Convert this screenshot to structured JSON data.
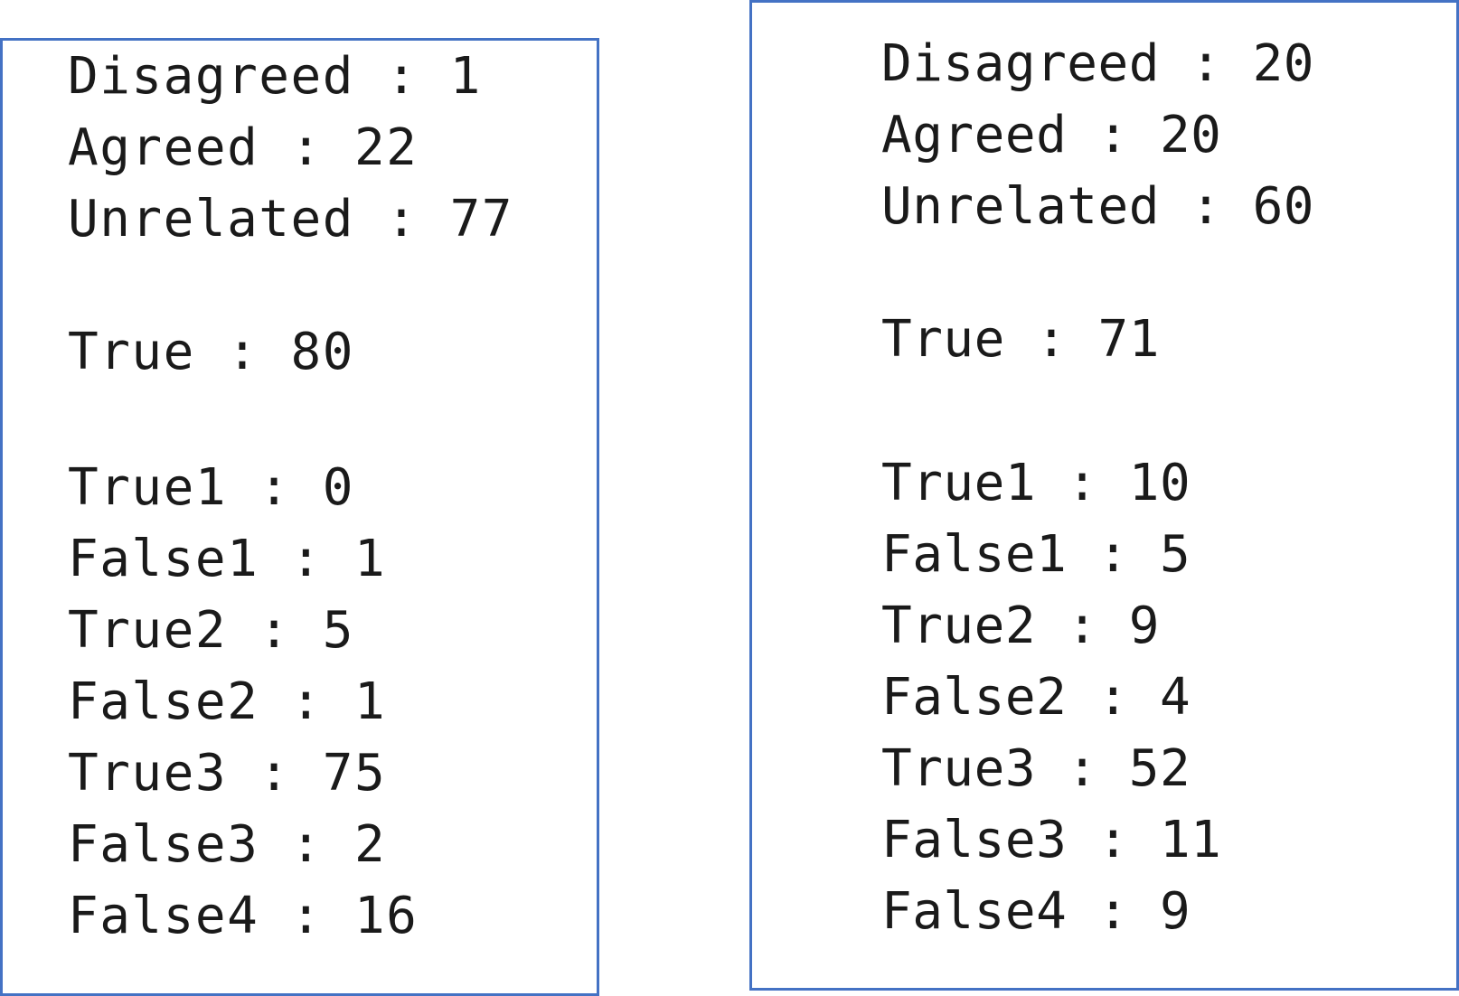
{
  "accent_border_color": "#4472c4",
  "text_color": "#1a1a1a",
  "left_panel": {
    "summary": [
      {
        "label": "Disagreed",
        "value": "1"
      },
      {
        "label": "Agreed",
        "value": "22"
      },
      {
        "label": "Unrelated",
        "value": "77"
      }
    ],
    "total": {
      "label": "True",
      "value": "80"
    },
    "details": [
      {
        "label": "True1",
        "value": "0"
      },
      {
        "label": "False1",
        "value": "1"
      },
      {
        "label": "True2",
        "value": "5"
      },
      {
        "label": "False2",
        "value": "1"
      },
      {
        "label": "True3",
        "value": "75"
      },
      {
        "label": "False3",
        "value": "2"
      },
      {
        "label": "False4",
        "value": "16"
      }
    ]
  },
  "right_panel": {
    "summary": [
      {
        "label": "Disagreed",
        "value": "20"
      },
      {
        "label": "Agreed",
        "value": "20"
      },
      {
        "label": "Unrelated",
        "value": "60"
      }
    ],
    "total": {
      "label": "True",
      "value": "71"
    },
    "details": [
      {
        "label": "True1",
        "value": "10"
      },
      {
        "label": "False1",
        "value": "5"
      },
      {
        "label": "True2",
        "value": "9"
      },
      {
        "label": "False2",
        "value": "4"
      },
      {
        "label": "True3",
        "value": "52"
      },
      {
        "label": "False3",
        "value": "11"
      },
      {
        "label": "False4",
        "value": "9"
      }
    ]
  },
  "separator": " : "
}
